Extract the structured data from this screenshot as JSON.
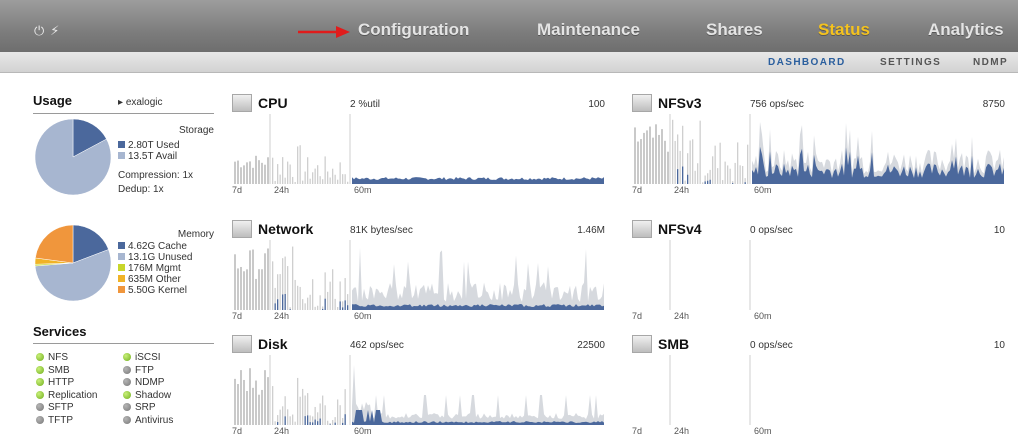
{
  "topnav": {
    "items": [
      "Configuration",
      "Maintenance",
      "Shares",
      "Status",
      "Analytics"
    ],
    "active": "Status",
    "icons": [
      "power-icon",
      "refresh-icon"
    ]
  },
  "subnav": {
    "items": [
      "DASHBOARD",
      "SETTINGS",
      "NDMP"
    ],
    "active": "DASHBOARD"
  },
  "usage": {
    "title": "Usage",
    "pool": "exalogic",
    "storage": {
      "label": "Storage",
      "used": "2.80T Used",
      "avail": "13.5T Avail",
      "compression": "Compression: 1x",
      "dedup": "Dedup: 1x",
      "slices": [
        {
          "name": "Used",
          "value": 2.8,
          "color": "#4b689c"
        },
        {
          "name": "Avail",
          "value": 13.5,
          "color": "#a7b6d0"
        }
      ]
    },
    "memory": {
      "label": "Memory",
      "rows": [
        "4.62G Cache",
        "13.1G Unused",
        "176M Mgmt",
        "635M Other",
        "5.50G Kernel"
      ],
      "colors": [
        "#4b689c",
        "#a7b6d0",
        "#c8d62a",
        "#f0b326",
        "#f0963c"
      ],
      "values": [
        4.62,
        13.1,
        0.176,
        0.635,
        5.5
      ]
    }
  },
  "services": {
    "title": "Services",
    "items": [
      {
        "name": "NFS",
        "on": true
      },
      {
        "name": "iSCSI",
        "on": true
      },
      {
        "name": "SMB",
        "on": true
      },
      {
        "name": "FTP",
        "on": false
      },
      {
        "name": "HTTP",
        "on": true
      },
      {
        "name": "NDMP",
        "on": false
      },
      {
        "name": "Replication",
        "on": true
      },
      {
        "name": "Shadow",
        "on": true
      },
      {
        "name": "SFTP",
        "on": false
      },
      {
        "name": "SRP",
        "on": false
      },
      {
        "name": "TFTP",
        "on": false
      },
      {
        "name": "Antivirus",
        "on": false
      }
    ]
  },
  "panels": [
    {
      "id": "cpu",
      "title": "CPU",
      "value": "2 %util",
      "max": "100",
      "pattern": "cpu"
    },
    {
      "id": "nfsv3",
      "title": "NFSv3",
      "value": "756 ops/sec",
      "max": "8750",
      "pattern": "nfs"
    },
    {
      "id": "network",
      "title": "Network",
      "value": "81K bytes/sec",
      "max": "1.46M",
      "pattern": "net"
    },
    {
      "id": "nfsv4",
      "title": "NFSv4",
      "value": "0 ops/sec",
      "max": "10",
      "pattern": "empty"
    },
    {
      "id": "disk",
      "title": "Disk",
      "value": "462 ops/sec",
      "max": "22500",
      "pattern": "disk"
    },
    {
      "id": "smb",
      "title": "SMB",
      "value": "0 ops/sec",
      "max": "10",
      "pattern": "empty"
    }
  ],
  "time_labels": [
    "7d",
    "24h",
    "60m"
  ],
  "colors": {
    "accent": "#f4c21f",
    "series": "#4b689c",
    "series_light": "#d6d9de",
    "arrow": "#e01c1c"
  }
}
